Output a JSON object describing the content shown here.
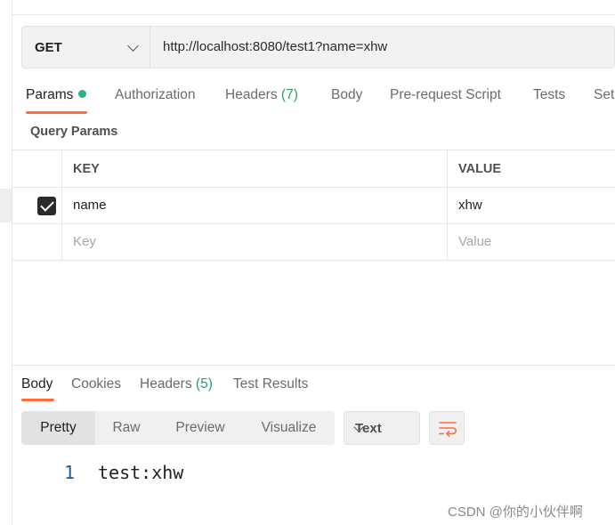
{
  "request": {
    "method": "GET",
    "url": "http://localhost:8080/test1?name=xhw"
  },
  "request_tabs": {
    "params": "Params",
    "authorization": "Authorization",
    "headers": "Headers",
    "headers_count": "(7)",
    "body": "Body",
    "pre_request": "Pre-request Script",
    "tests": "Tests",
    "settings": "Set"
  },
  "query_params": {
    "title": "Query Params",
    "columns": {
      "key": "KEY",
      "value": "VALUE"
    },
    "rows": [
      {
        "key": "name",
        "value": "xhw",
        "checked": true
      }
    ],
    "placeholder": {
      "key": "Key",
      "value": "Value"
    }
  },
  "response_tabs": {
    "body": "Body",
    "cookies": "Cookies",
    "headers": "Headers",
    "headers_count": "(5)",
    "test_results": "Test Results"
  },
  "view_modes": {
    "pretty": "Pretty",
    "raw": "Raw",
    "preview": "Preview",
    "visualize": "Visualize"
  },
  "format": "Text",
  "response_body": {
    "line_number": "1",
    "text": "test:xhw"
  },
  "watermark": "CSDN @你的小伙伴啊",
  "colors": {
    "accent": "#ff6c37",
    "status_green": "#26b47f",
    "line_number": "#1c5d99"
  }
}
